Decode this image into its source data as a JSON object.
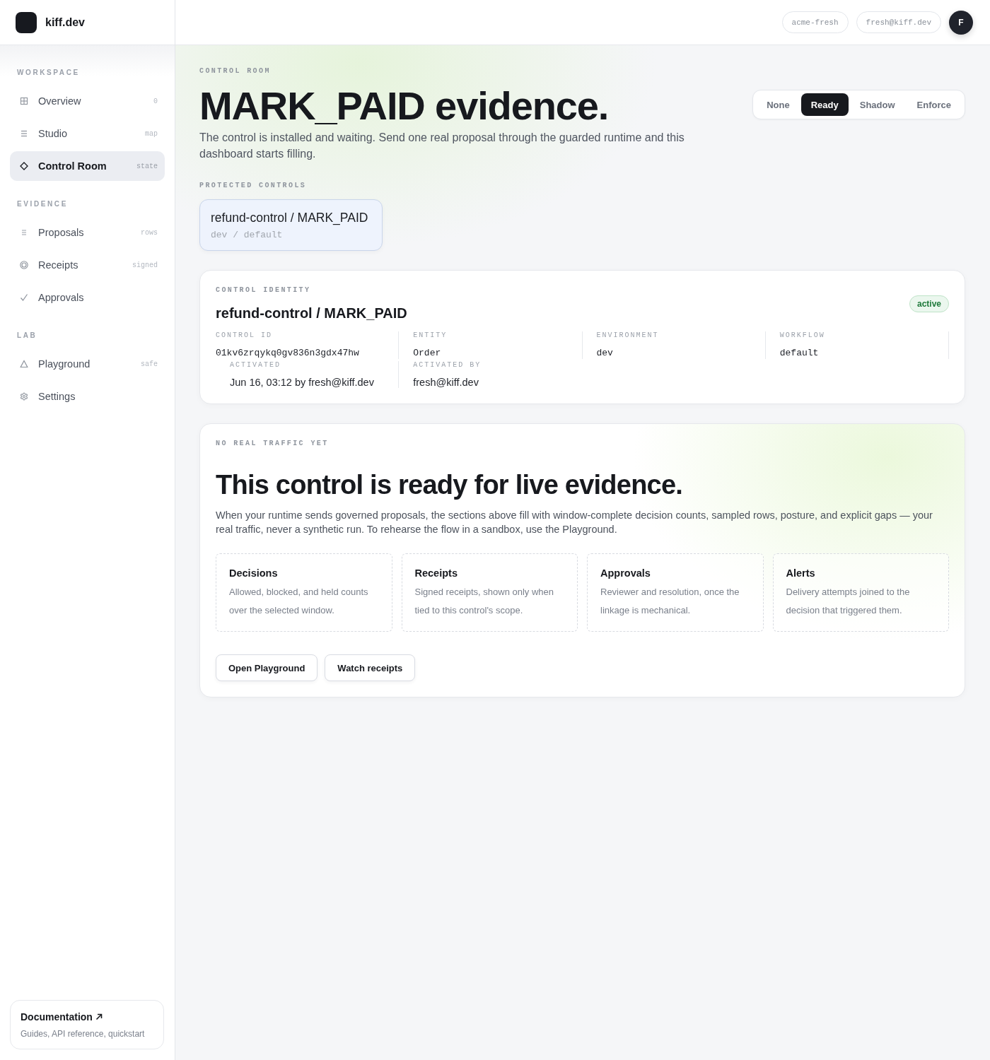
{
  "brand": {
    "name": "kiff.dev"
  },
  "header": {
    "workspace": "acme-fresh",
    "user": "fresh@kiff.dev",
    "avatar": "F"
  },
  "sidebar": {
    "sections": [
      {
        "title": "WORKSPACE",
        "items": [
          {
            "label": "Overview",
            "hint": "0",
            "selected": false
          },
          {
            "label": "Studio",
            "hint": "map",
            "selected": false
          },
          {
            "label": "Control Room",
            "hint": "state",
            "selected": true
          }
        ]
      },
      {
        "title": "EVIDENCE",
        "items": [
          {
            "label": "Proposals",
            "hint": "rows",
            "selected": false
          },
          {
            "label": "Receipts",
            "hint": "signed",
            "selected": false
          },
          {
            "label": "Approvals",
            "selected": false
          }
        ]
      },
      {
        "title": "LAB",
        "items": [
          {
            "label": "Playground",
            "hint": "safe",
            "selected": false
          },
          {
            "label": "Settings",
            "selected": false
          }
        ]
      }
    ],
    "docs": {
      "title": "Documentation",
      "subtitle": "Guides, API reference, quickstart"
    }
  },
  "page": {
    "eyebrow": "CONTROL ROOM",
    "title": "MARK_PAID evidence.",
    "subtitle": "The control is installed and waiting. Send one real proposal through the guarded runtime and this dashboard starts filling.",
    "modes": [
      {
        "label": "None",
        "selected": false
      },
      {
        "label": "Ready",
        "selected": true
      },
      {
        "label": "Shadow",
        "selected": false
      },
      {
        "label": "Enforce",
        "selected": false
      }
    ]
  },
  "protected_controls": {
    "label": "PROTECTED CONTROLS",
    "items": [
      {
        "name": "refund-control / MARK_PAID",
        "scope": "dev / default",
        "selected": true
      }
    ]
  },
  "identity": {
    "label": "CONTROL IDENTITY",
    "title": "refund-control / MARK_PAID",
    "status": "active",
    "fields": [
      {
        "label": "CONTROL ID",
        "value": "01kv6zrqykq0gv836n3gdx47hw",
        "kind": "mono"
      },
      {
        "label": "ENTITY",
        "value": "Order",
        "kind": "mono"
      },
      {
        "label": "ENVIRONMENT",
        "value": "dev",
        "kind": "mono"
      },
      {
        "label": "WORKFLOW",
        "value": "default",
        "kind": "mono"
      },
      {
        "label": "ACTIVATED",
        "value": "Jun 16, 03:12 by fresh@kiff.dev",
        "kind": "text"
      },
      {
        "label": "ACTIVATED BY",
        "value": "fresh@kiff.dev",
        "kind": "text"
      }
    ]
  },
  "empty_state": {
    "label": "NO REAL TRAFFIC YET",
    "title": "This control is ready for live evidence.",
    "body": "When your runtime sends governed proposals, the sections above fill with window-complete decision counts, sampled rows, posture, and explicit gaps — your real traffic, never a synthetic run. To rehearse the flow in a sandbox, use the Playground.",
    "cards": [
      {
        "title": "Decisions",
        "text": "Allowed, blocked, and held counts over the selected window."
      },
      {
        "title": "Receipts",
        "text": "Signed receipts, shown only when tied to this control's scope."
      },
      {
        "title": "Approvals",
        "text": "Reviewer and resolution, once the linkage is mechanical."
      },
      {
        "title": "Alerts",
        "text": "Delivery attempts joined to the decision that triggered them."
      }
    ],
    "actions": [
      "Open Playground",
      "Watch receipts"
    ]
  }
}
